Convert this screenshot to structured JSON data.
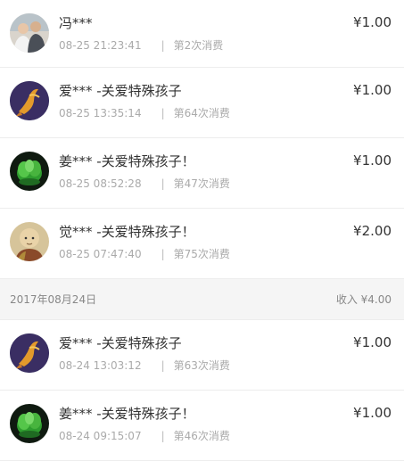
{
  "records_before": [
    {
      "name": "冯***",
      "time": "08-25 21:23:41",
      "count": "第2次消费",
      "amount": "¥1.00",
      "avatar": "two-men-photo-avatar"
    },
    {
      "name": "爱*** -关爱特殊孩子",
      "time": "08-25 13:35:14",
      "count": "第64次消费",
      "amount": "¥1.00",
      "avatar": "koi-fish-avatar"
    },
    {
      "name": "姜*** -关爱特殊孩子！",
      "time": "08-25 08:52:28",
      "count": "第47次消费",
      "amount": "¥1.00",
      "avatar": "green-lotus-avatar"
    },
    {
      "name": "觉*** -关爱特殊孩子！",
      "time": "08-25 07:47:40",
      "count": "第75次消费",
      "amount": "¥2.00",
      "avatar": "monk-avatar"
    }
  ],
  "day_header": {
    "date": "2017年08月24日",
    "income": "收入 ¥4.00"
  },
  "records_after": [
    {
      "name": "爱*** -关爱特殊孩子",
      "time": "08-24 13:03:12",
      "count": "第63次消费",
      "amount": "¥1.00",
      "avatar": "koi-fish-avatar"
    },
    {
      "name": "姜*** -关爱特殊孩子！",
      "time": "08-24 09:15:07",
      "count": "第46次消费",
      "amount": "¥1.00",
      "avatar": "green-lotus-avatar"
    }
  ],
  "separator": "|"
}
